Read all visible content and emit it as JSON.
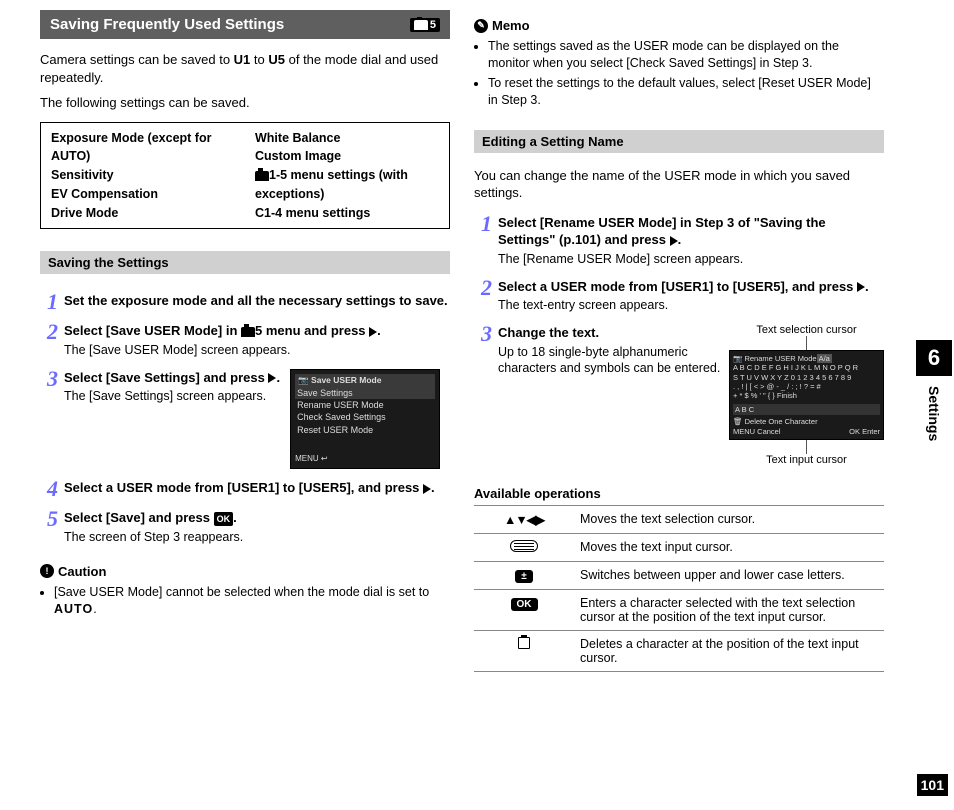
{
  "chapter": {
    "number": "6",
    "label": "Settings"
  },
  "page_number": "101",
  "left": {
    "title": "Saving Frequently Used Settings",
    "title_badge_suffix": "5",
    "intro": {
      "line1_pre": "Camera settings can be saved to ",
      "u1": "U1",
      "mid": " to ",
      "u5": "U5",
      "line1_post": " of the mode dial and used repeatedly.",
      "line2": "The following settings can be saved."
    },
    "saveable": {
      "col1": [
        "Exposure Mode (except for AUTO)",
        "Sensitivity",
        "EV Compensation",
        "Drive Mode"
      ],
      "col2": [
        "White Balance",
        "Custom Image",
        "1-5 menu settings (with exceptions)",
        "C1-4 menu settings"
      ],
      "col2_cam_prefix_idx": 2
    },
    "saving_header": "Saving the Settings",
    "steps": [
      {
        "n": "1",
        "head": "Set the exposure mode and all the necessary settings to save."
      },
      {
        "n": "2",
        "head_parts": [
          "Select [Save USER Mode] in ",
          "5 menu and press ",
          "."
        ],
        "desc": "The [Save USER Mode] screen appears."
      },
      {
        "n": "3",
        "head_parts": [
          "Select [Save Settings] and press ",
          "."
        ],
        "desc": "The [Save Settings] screen appears.",
        "screenshot": {
          "title": "Save USER Mode",
          "items": [
            "Save Settings",
            "Rename USER Mode",
            "Check Saved Settings",
            "Reset USER Mode"
          ],
          "footer_left": "MENU"
        }
      },
      {
        "n": "4",
        "head_parts": [
          "Select a USER mode from [USER1] to [USER5], and press ",
          "."
        ]
      },
      {
        "n": "5",
        "head_parts": [
          "Select [Save] and press ",
          "."
        ],
        "ok": true,
        "desc": "The screen of Step 3 reappears."
      }
    ],
    "caution": {
      "label": "Caution",
      "items": [
        "[Save USER Mode] cannot be selected when the mode dial is set to AUTO."
      ]
    }
  },
  "right": {
    "memo": {
      "label": "Memo",
      "items": [
        "The settings saved as the USER mode can be displayed on the monitor when you select [Check Saved Settings] in Step 3.",
        "To reset the settings to the default values, select [Reset USER Mode] in Step 3."
      ]
    },
    "edit_header": "Editing a Setting Name",
    "edit_intro": "You can change the name of the USER mode in which you saved settings.",
    "steps": [
      {
        "n": "1",
        "head_parts": [
          "Select [Rename USER Mode] in Step 3 of \"Saving the Settings\" (p.101) and press ",
          "."
        ],
        "desc": "The [Rename USER Mode] screen appears."
      },
      {
        "n": "2",
        "head_parts": [
          "Select a USER mode from [USER1] to [USER5], and press ",
          "."
        ],
        "desc": "The text-entry screen appears."
      },
      {
        "n": "3",
        "head": "Change the text.",
        "desc": "Up to 18 single-byte alphanumeric characters and symbols can be entered.",
        "annot_top": "Text selection cursor",
        "annot_bottom": "Text input cursor",
        "screenshot": {
          "title": "Rename USER Mode",
          "mode_badge": "A/a",
          "rows": [
            "A B C D E F G H I J K L M N O P Q R",
            "S T U V W X Y Z 0 1 2 3 4 5 6 7 8 9",
            ". , ! | [ < > @ - _ / : ; ! ? = #",
            "+ * $ % ' \" { }        Finish"
          ],
          "current": "A B C",
          "delete_label": "Delete One Character",
          "cancel": "Cancel",
          "enter": "Enter"
        }
      }
    ],
    "ops_title": "Available operations",
    "ops": [
      {
        "key_type": "dpad",
        "desc": "Moves the text selection cursor."
      },
      {
        "key_type": "dial",
        "desc": "Moves the text input cursor."
      },
      {
        "key_type": "key",
        "key_text": "±",
        "desc": "Switches between upper and lower case letters."
      },
      {
        "key_type": "key",
        "key_text": "OK",
        "desc": "Enters a character selected with the text selection cursor at the position of the text input cursor."
      },
      {
        "key_type": "trash",
        "desc": "Deletes a character at the position of the text input cursor."
      }
    ]
  }
}
